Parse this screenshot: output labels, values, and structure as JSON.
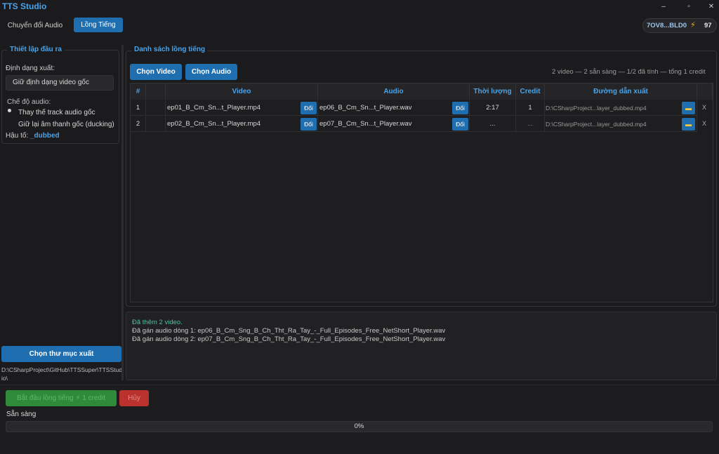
{
  "app": {
    "title": "TTS Studio"
  },
  "window_controls": {
    "minimize": "–",
    "maximize": "▫",
    "close": "✕"
  },
  "tabs": [
    {
      "label": "Chuyển đổi Audio",
      "active": false
    },
    {
      "label": "Lồng Tiếng",
      "active": true
    }
  ],
  "account": {
    "id": "7OV8...BLD0",
    "credits": "97",
    "icon": "lightning-icon"
  },
  "settings": {
    "title": "Thiết lập đầu ra",
    "format_label": "Định dạng xuất:",
    "format_value": "Giữ định dạng video gốc",
    "audio_mode_label": "Chế độ audio:",
    "audio_modes": [
      "Thay thế track audio gốc",
      "Giữ lại âm thanh gốc (ducking)"
    ],
    "audio_mode_selected": 0,
    "suffix_label": "Hậu tố:",
    "suffix_value": "_dubbed"
  },
  "output": {
    "button_label": "Chọn thư mục xuất",
    "path": "D:\\CSharpProject\\GitHub\\TTSSuper\\TTSStudio\\"
  },
  "dub_list": {
    "title": "Danh sách lồng tiếng",
    "choose_video_label": "Chọn Video",
    "choose_audio_label": "Chọn Audio",
    "summary": "2 video — 2 sẵn sàng — 1/2 đã tính — tổng 1 credit",
    "columns": [
      "#",
      "",
      "Video",
      "Audio",
      "Thời lượng",
      "Credit",
      "Đường dẫn xuất",
      ""
    ],
    "change_label": "Đổi",
    "remove_label": "X",
    "rows": [
      {
        "index": "1",
        "video": "ep01_B_Cm_Sn...t_Player.mp4",
        "audio": "ep06_B_Cm_Sn...t_Player.wav",
        "duration": "2:17",
        "credit": "1",
        "output": "D:\\CSharpProject...layer_dubbed.mp4"
      },
      {
        "index": "2",
        "video": "ep02_B_Cm_Sn...t_Player.mp4",
        "audio": "ep07_B_Cm_Sn...t_Player.wav",
        "duration": "...",
        "credit": "...",
        "output": "D:\\CSharpProject...layer_dubbed.mp4"
      }
    ]
  },
  "log": [
    {
      "text": "Đã thêm 2 video.",
      "color": "#4fc3a1"
    },
    {
      "text": "Đã gán audio dòng 1: ep06_B_Cm_Sng_B_Ch_Tht_Ra_Tay_-_Full_Episodes_Free_NetShort_Player.wav",
      "color": "#c8c8c8"
    },
    {
      "text": "Đã gán audio dòng 2: ep07_B_Cm_Sng_B_Ch_Tht_Ra_Tay_-_Full_Episodes_Free_NetShort_Player.wav",
      "color": "#c8c8c8"
    }
  ],
  "actions": {
    "start_label": "Bắt đầu lồng tiếng ⚡ 1 credit",
    "cancel_label": "Hủy"
  },
  "status": {
    "text": "Sẵn sàng",
    "progress": 0,
    "progress_label": "0%"
  },
  "colors": {
    "accent": "#1f6fb0",
    "heading": "#4aa3e8",
    "start": "#2f8a3a",
    "cancel": "#b9322e"
  }
}
